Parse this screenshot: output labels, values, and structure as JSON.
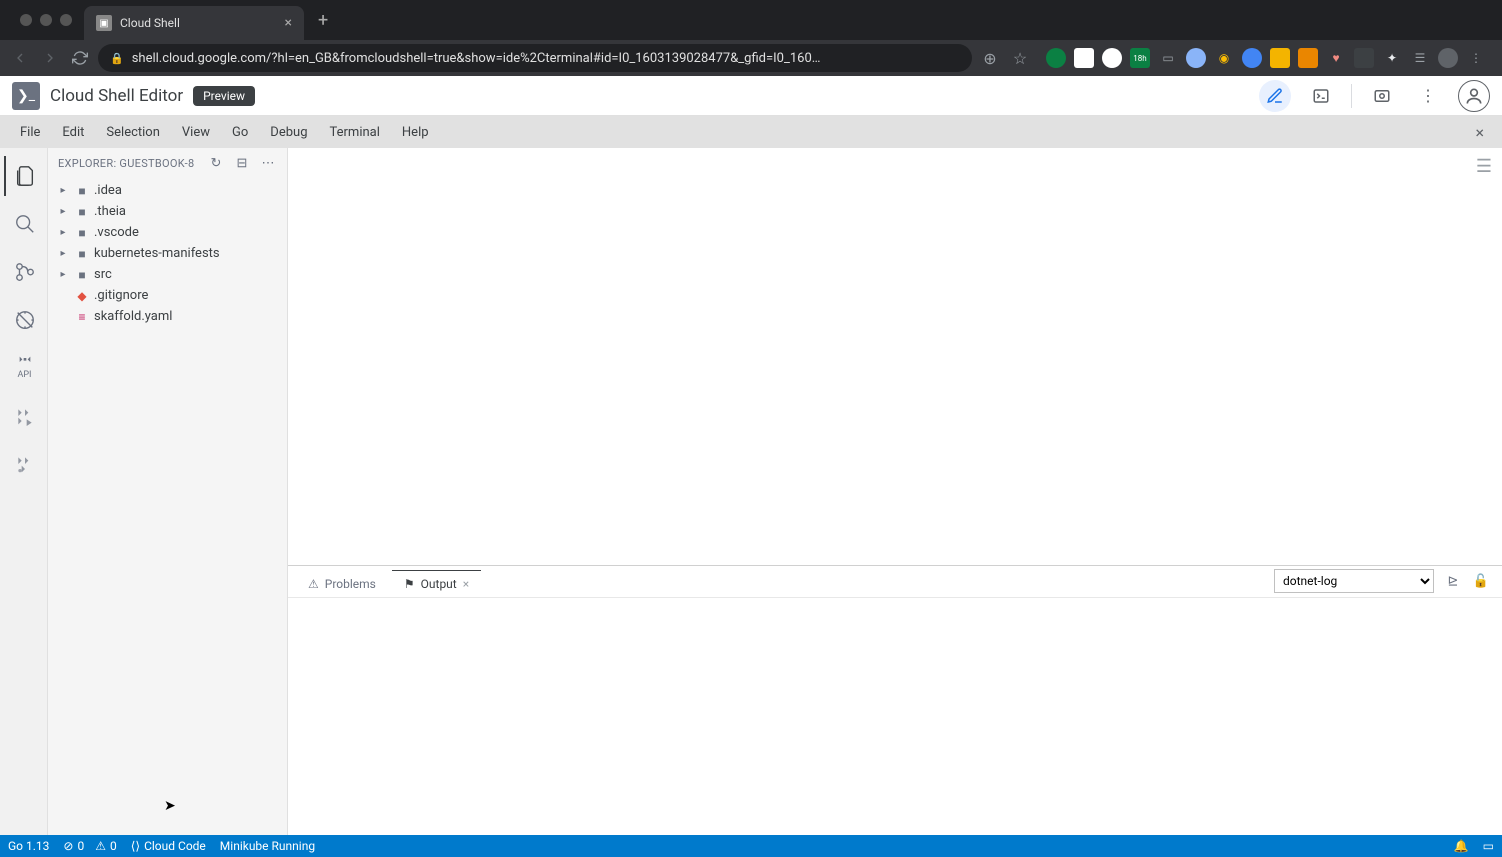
{
  "browser": {
    "tab_title": "Cloud Shell",
    "url": "shell.cloud.google.com/?hl=en_GB&fromcloudshell=true&show=ide%2Cterminal#id=I0_1603139028477&_gfid=I0_160…",
    "extension_badge": "18h"
  },
  "header": {
    "title": "Cloud Shell Editor",
    "preview": "Preview"
  },
  "menu": {
    "items": [
      "File",
      "Edit",
      "Selection",
      "View",
      "Go",
      "Debug",
      "Terminal",
      "Help"
    ]
  },
  "sidebar": {
    "title": "EXPLORER: GUESTBOOK-8",
    "tree": [
      {
        "type": "folder",
        "name": ".idea"
      },
      {
        "type": "folder",
        "name": ".theia"
      },
      {
        "type": "folder",
        "name": ".vscode"
      },
      {
        "type": "folder",
        "name": "kubernetes-manifests"
      },
      {
        "type": "folder",
        "name": "src"
      },
      {
        "type": "git",
        "name": ".gitignore"
      },
      {
        "type": "yaml",
        "name": "skaffold.yaml"
      }
    ]
  },
  "activity": {
    "api_label": "API"
  },
  "panel": {
    "tabs": {
      "problems": "Problems",
      "output": "Output"
    },
    "select_value": "dotnet-log"
  },
  "status": {
    "go": "Go 1.13",
    "errors": "0",
    "warnings": "0",
    "cloud_code": "Cloud Code",
    "minikube": "Minikube Running"
  }
}
